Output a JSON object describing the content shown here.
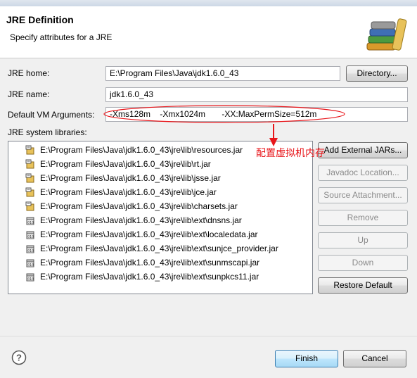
{
  "dialog": {
    "title": "JRE Definition",
    "subtitle": "Specify attributes for a JRE",
    "banner_icon": "books-icon"
  },
  "form": {
    "jre_home_label": "JRE home:",
    "jre_home_value": "E:\\Program Files\\Java\\jdk1.6.0_43",
    "directory_button": "Directory...",
    "jre_name_label": "JRE name:",
    "jre_name_value": "jdk1.6.0_43",
    "vm_args_label": "Default VM Arguments:",
    "vm_args_value": "-Xms128m    -Xmx1024m       -XX:MaxPermSize=512m",
    "libraries_label": "JRE system libraries:"
  },
  "libraries": [
    {
      "path": "E:\\Program Files\\Java\\jdk1.6.0_43\\jre\\lib\\resources.jar",
      "icon": "jar-icon"
    },
    {
      "path": "E:\\Program Files\\Java\\jdk1.6.0_43\\jre\\lib\\rt.jar",
      "icon": "jar-icon"
    },
    {
      "path": "E:\\Program Files\\Java\\jdk1.6.0_43\\jre\\lib\\jsse.jar",
      "icon": "jar-icon"
    },
    {
      "path": "E:\\Program Files\\Java\\jdk1.6.0_43\\jre\\lib\\jce.jar",
      "icon": "jar-icon"
    },
    {
      "path": "E:\\Program Files\\Java\\jdk1.6.0_43\\jre\\lib\\charsets.jar",
      "icon": "jar-icon"
    },
    {
      "path": "E:\\Program Files\\Java\\jdk1.6.0_43\\jre\\lib\\ext\\dnsns.jar",
      "icon": "binary-jar-icon"
    },
    {
      "path": "E:\\Program Files\\Java\\jdk1.6.0_43\\jre\\lib\\ext\\localedata.jar",
      "icon": "binary-jar-icon"
    },
    {
      "path": "E:\\Program Files\\Java\\jdk1.6.0_43\\jre\\lib\\ext\\sunjce_provider.jar",
      "icon": "binary-jar-icon"
    },
    {
      "path": "E:\\Program Files\\Java\\jdk1.6.0_43\\jre\\lib\\ext\\sunmscapi.jar",
      "icon": "binary-jar-icon"
    },
    {
      "path": "E:\\Program Files\\Java\\jdk1.6.0_43\\jre\\lib\\ext\\sunpkcs11.jar",
      "icon": "binary-jar-icon"
    }
  ],
  "side_buttons": {
    "add_external_jars": "Add External JARs...",
    "javadoc_location": "Javadoc Location...",
    "source_attachment": "Source Attachment...",
    "remove": "Remove",
    "up": "Up",
    "down": "Down",
    "restore_default": "Restore Default"
  },
  "footer": {
    "finish": "Finish",
    "cancel": "Cancel",
    "help_icon": "help-icon"
  },
  "annotation": {
    "note": "配置虚拟机内存",
    "color": "#e8161b"
  }
}
